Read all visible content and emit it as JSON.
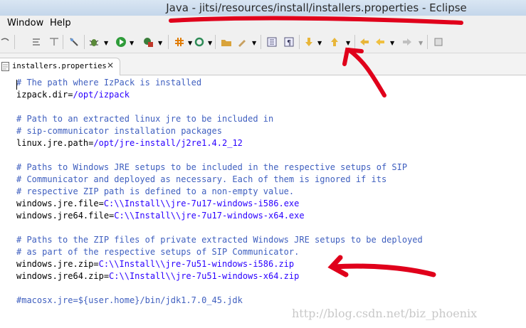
{
  "window": {
    "title": "Java - jitsi/resources/install/installers.properties - Eclipse"
  },
  "menu": {
    "items": [
      "Window",
      "Help"
    ]
  },
  "toolbar": {
    "icons": [
      "format-icon",
      "format2-icon",
      "pin-icon",
      "debug-icon",
      "run-icon",
      "external-tools-icon",
      "new-icon",
      "refresh-icon",
      "open-folder-icon",
      "brush-icon",
      "toggle-mark-icon",
      "paragraph-icon",
      "annotation-down-icon",
      "annotation-up-icon",
      "last-edit-icon",
      "back-icon",
      "forward-icon",
      "pin2-icon"
    ]
  },
  "editor": {
    "tab_label": "installers.properties",
    "lines": [
      {
        "t": "# The path where IzPack is installed",
        "k": "comment"
      },
      {
        "key": "izpack.dir=",
        "val": "/opt/izpack",
        "k": "code"
      },
      {
        "t": "",
        "k": "blank"
      },
      {
        "t": "# Path to an extracted linux jre to be included in",
        "k": "comment"
      },
      {
        "t": "# sip-communicator installation packages",
        "k": "comment"
      },
      {
        "key": "linux.jre.path=",
        "val": "/opt/jre-install/j2re1.4.2_12",
        "k": "code"
      },
      {
        "t": "",
        "k": "blank"
      },
      {
        "t": "# Paths to Windows JRE setups to be included in the respective setups of SIP",
        "k": "comment"
      },
      {
        "t": "# Communicator and deployed as necessary. Each of them is ignored if its",
        "k": "comment"
      },
      {
        "t": "# respective ZIP path is defined to a non-empty value.",
        "k": "comment"
      },
      {
        "key": "windows.jre.file=",
        "val": "C:\\\\Install\\\\jre-7u17-windows-i586.exe",
        "k": "code"
      },
      {
        "key": "windows.jre64.file=",
        "val": "C:\\\\Install\\\\jre-7u17-windows-x64.exe",
        "k": "code"
      },
      {
        "t": "",
        "k": "blank"
      },
      {
        "t": "# Paths to the ZIP files of private extracted Windows JRE setups to be deployed",
        "k": "comment"
      },
      {
        "t": "# as part of the respective setups of SIP Communicator.",
        "k": "comment"
      },
      {
        "key": "windows.jre.zip=",
        "val": "C:\\\\Install\\\\jre-7u51-windows-i586.zip",
        "k": "code"
      },
      {
        "key": "windows.jre64.zip=",
        "val": "C:\\\\Install\\\\jre-7u51-windows-x64.zip",
        "k": "code"
      },
      {
        "t": "",
        "k": "blank"
      },
      {
        "t": "#macosx.jre=${user.home}/bin/jdk1.7.0_45.jdk",
        "k": "comment"
      }
    ]
  },
  "watermark": "http://blog.csdn.net/biz_phoenix",
  "colors": {
    "comment": "#3f5fbf",
    "value": "#2a00ff",
    "annotation": "#e0001b"
  }
}
